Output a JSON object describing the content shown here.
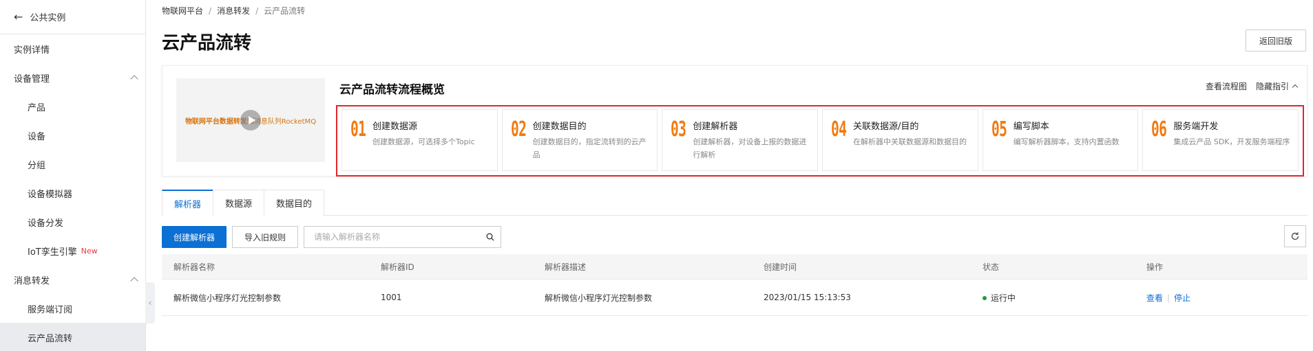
{
  "sidebar": {
    "back_label": "公共实例",
    "items": [
      {
        "label": "实例详情"
      },
      {
        "label": "设备管理"
      },
      {
        "label": "产品"
      },
      {
        "label": "设备"
      },
      {
        "label": "分组"
      },
      {
        "label": "设备模拟器"
      },
      {
        "label": "设备分发"
      },
      {
        "label": "IoT孪生引擎",
        "badge": "New"
      },
      {
        "label": "消息转发"
      },
      {
        "label": "服务端订阅"
      },
      {
        "label": "云产品流转"
      }
    ]
  },
  "breadcrumb": [
    "物联网平台",
    "消息转发",
    "云产品流转"
  ],
  "page_title": "云产品流转",
  "return_button": "返回旧版",
  "overview": {
    "video_text": "物联网平台数据转发到消息队列RocketMQ",
    "video_text_a": "物联网平台数据转发到",
    "video_text_b": "消息队列RocketMQ",
    "title": "云产品流转流程概览",
    "link_flowchart": "查看流程图",
    "link_hide": "隐藏指引",
    "steps": [
      {
        "num": "01",
        "title": "创建数据源",
        "desc": "创建数据源，可选择多个Topic"
      },
      {
        "num": "02",
        "title": "创建数据目的",
        "desc": "创建数据目的，指定流转到的云产品"
      },
      {
        "num": "03",
        "title": "创建解析器",
        "desc": "创建解析器，对设备上报的数据进行解析"
      },
      {
        "num": "04",
        "title": "关联数据源/目的",
        "desc": "在解析器中关联数据源和数据目的"
      },
      {
        "num": "05",
        "title": "编写脚本",
        "desc": "编写解析器脚本，支持内置函数"
      },
      {
        "num": "06",
        "title": "服务端开发",
        "desc": "集成云产品 SDK，开发服务端程序"
      }
    ]
  },
  "tabs": [
    {
      "label": "解析器",
      "active": true
    },
    {
      "label": "数据源",
      "active": false
    },
    {
      "label": "数据目的",
      "active": false
    }
  ],
  "toolbar": {
    "create_label": "创建解析器",
    "import_label": "导入旧规则",
    "search_placeholder": "请输入解析器名称"
  },
  "table": {
    "headers": [
      "解析器名称",
      "解析器ID",
      "解析器描述",
      "创建时间",
      "状态",
      "操作"
    ],
    "rows": [
      {
        "name": "解析微信小程序灯光控制参数",
        "id": "1001",
        "desc": "解析微信小程序灯光控制参数",
        "created": "2023/01/15 15:13:53",
        "status": "运行中",
        "actions": [
          "查看",
          "停止"
        ]
      }
    ]
  },
  "colors": {
    "primary": "#0b6fd4",
    "step_number": "#f27a0f",
    "highlight_border": "#e0262d",
    "status_running": "#1f9a3a",
    "badge_new": "#e4393c"
  }
}
